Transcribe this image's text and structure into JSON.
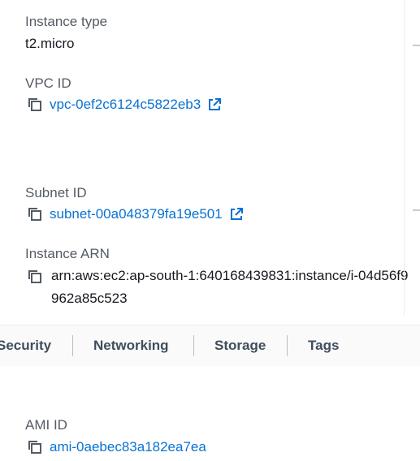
{
  "details": {
    "instance_type": {
      "label": "Instance type",
      "value": "t2.micro"
    },
    "vpc_id": {
      "label": "VPC ID",
      "value": "vpc-0ef2c6124c5822eb3"
    },
    "subnet_id": {
      "label": "Subnet ID",
      "value": "subnet-00a048379fa19e501"
    },
    "instance_arn": {
      "label": "Instance ARN",
      "value": "arn:aws:ec2:ap-south-1:640168439831:instance/i-04d56f9962a85c523"
    }
  },
  "tabs": [
    {
      "label": "Security"
    },
    {
      "label": "Networking"
    },
    {
      "label": "Storage"
    },
    {
      "label": "Tags"
    }
  ],
  "ami": {
    "label": "AMI ID",
    "value": "ami-0aebec83a182ea7ea"
  },
  "colors": {
    "link": "#0972d3",
    "label": "#545b64",
    "text": "#16191f"
  },
  "icons": [
    "copy-icon",
    "external-link-icon"
  ]
}
